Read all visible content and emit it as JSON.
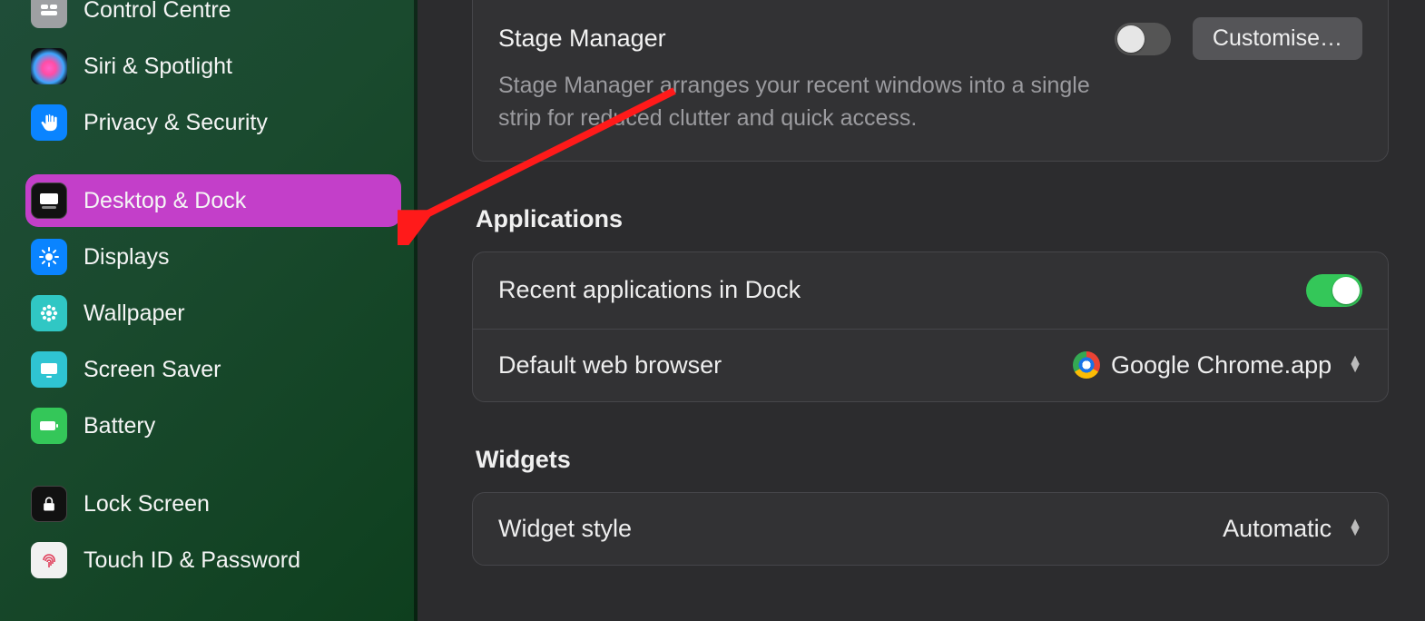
{
  "sidebar": {
    "items": [
      {
        "id": "control-centre",
        "label": "Control Centre",
        "iconClass": "ic-control",
        "glyph": "control-centre-icon"
      },
      {
        "id": "siri",
        "label": "Siri & Spotlight",
        "iconClass": "ic-siri",
        "glyph": "siri-icon"
      },
      {
        "id": "privacy",
        "label": "Privacy & Security",
        "iconClass": "ic-privacy",
        "glyph": "hand-icon"
      },
      {
        "id": "desktop-dock",
        "label": "Desktop & Dock",
        "iconClass": "ic-desktop",
        "glyph": "dock-icon",
        "selected": true
      },
      {
        "id": "displays",
        "label": "Displays",
        "iconClass": "ic-displays",
        "glyph": "sun-icon"
      },
      {
        "id": "wallpaper",
        "label": "Wallpaper",
        "iconClass": "ic-wallpaper",
        "glyph": "flower-icon"
      },
      {
        "id": "screensaver",
        "label": "Screen Saver",
        "iconClass": "ic-screensv",
        "glyph": "screensaver-icon"
      },
      {
        "id": "battery",
        "label": "Battery",
        "iconClass": "ic-battery",
        "glyph": "battery-icon"
      },
      {
        "id": "lock-screen",
        "label": "Lock Screen",
        "iconClass": "ic-lock",
        "glyph": "lock-icon"
      },
      {
        "id": "touchid",
        "label": "Touch ID & Password",
        "iconClass": "ic-touchid",
        "glyph": "fingerprint-icon"
      }
    ]
  },
  "main": {
    "stage_manager": {
      "title": "Stage Manager",
      "description": "Stage Manager arranges your recent windows into a single strip for reduced clutter and quick access.",
      "toggle_on": false,
      "customise_label": "Customise…"
    },
    "applications": {
      "header": "Applications",
      "recent_label": "Recent applications in Dock",
      "recent_toggle_on": true,
      "browser_label": "Default web browser",
      "browser_value": "Google Chrome.app"
    },
    "widgets": {
      "header": "Widgets",
      "style_label": "Widget style",
      "style_value": "Automatic"
    }
  }
}
